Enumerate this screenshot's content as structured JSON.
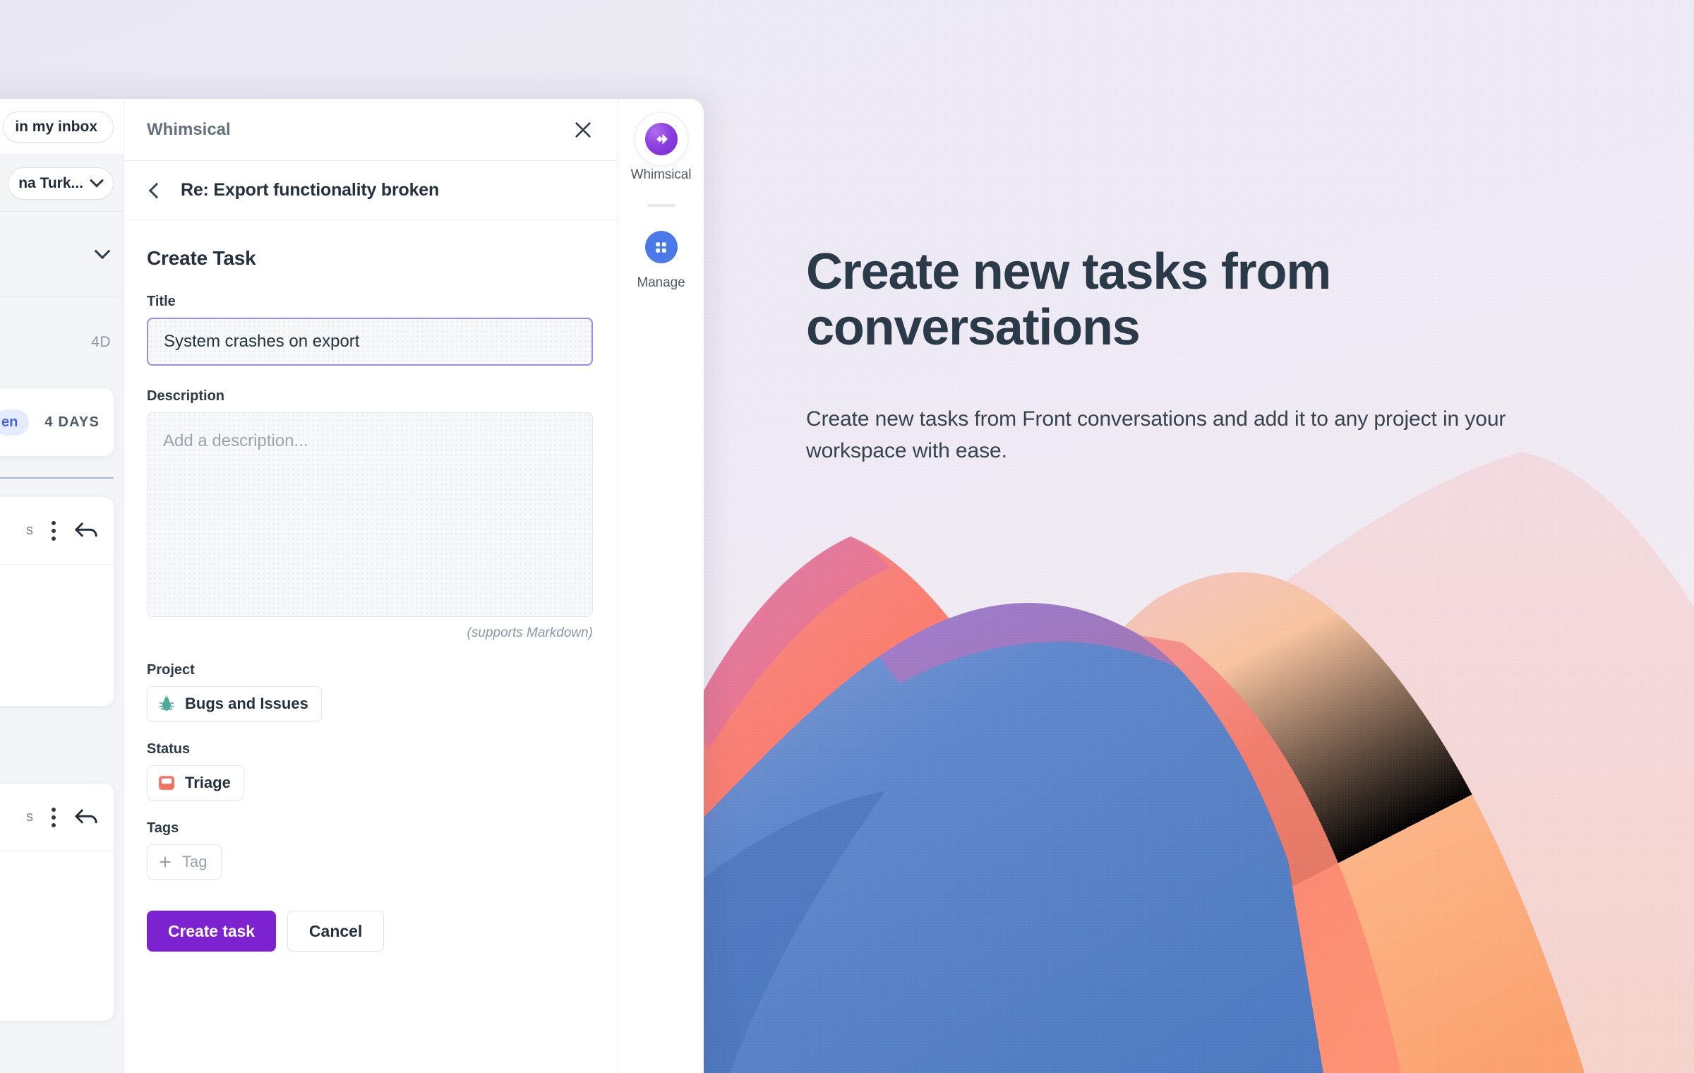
{
  "background": {
    "page_bg": "#e9e8f2",
    "accent_purple": "#7d22d1",
    "focus_border": "#9a8df0"
  },
  "hero": {
    "title": "Create new tasks from conversations",
    "subtitle": "Create new tasks from Front conversations and add it to any project in your workspace with ease.",
    "title_color": "#2b3a48"
  },
  "front_panel": {
    "inbox_filter_pill": "in my inbox",
    "assignee_dropdown": "na Turk...",
    "collapse_chevron_icon": "chevron-down-icon",
    "relative_time": "4D",
    "conversation_card": {
      "status_badge": "en",
      "age": "4 DAYS"
    },
    "message_cards": [
      {
        "meta": "s",
        "more_icon": "kebab-menu-icon",
        "reply_icon": "reply-arrow-icon"
      },
      {
        "meta": "s",
        "more_icon": "kebab-menu-icon",
        "reply_icon": "reply-arrow-icon"
      }
    ]
  },
  "plugin": {
    "titlebar": {
      "app_name": "Whimsical",
      "close_icon": "close-icon"
    },
    "subheader": {
      "back_icon": "chevron-left-icon",
      "conversation_subject": "Re: Export functionality broken"
    },
    "form": {
      "heading": "Create Task",
      "title_field": {
        "label": "Title",
        "value": "System crashes on export"
      },
      "description_field": {
        "label": "Description",
        "placeholder": "Add a description...",
        "hint": "(supports Markdown)"
      },
      "project_field": {
        "label": "Project",
        "value": "Bugs and Issues",
        "icon": "bug-icon",
        "icon_color": "#4aab96"
      },
      "status_field": {
        "label": "Status",
        "value": "Triage",
        "icon": "inbox-tray-icon",
        "icon_color": "#f2735f"
      },
      "tags_field": {
        "label": "Tags",
        "add_label": "Tag",
        "add_icon": "plus-icon"
      },
      "submit_button": "Create task",
      "cancel_button": "Cancel"
    }
  },
  "rail": {
    "items": [
      {
        "label": "Whimsical",
        "icon": "whimsical-diamond-icon",
        "color": "#8b3ee0",
        "selected": true
      },
      {
        "label": "Manage",
        "icon": "grid-apps-icon",
        "color": "#4a7ae8",
        "selected": false
      }
    ]
  }
}
